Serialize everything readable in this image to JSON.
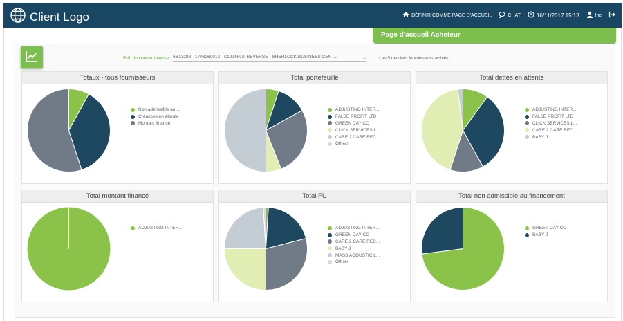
{
  "header": {
    "logo_text": "Client Logo",
    "nav": {
      "home_label": "DÉFINIR COMME PAGE D'ACCUEIL",
      "chat_label": "CHAT",
      "datetime": "16/11/2017 15:13",
      "user_label": "Inc"
    },
    "bg_color": "#194763"
  },
  "banner": {
    "title": "Page d'accueil Acheteur",
    "color": "#7cbf4e"
  },
  "filter": {
    "contract_label": "Réf. du contrat reverse",
    "contract_value": "6B13288 - 1703260012 - CONTRAT REVERSE - SHERLOCK BUSINESS CENT...",
    "info_text": "Les 5 derniers fournisseurs activés"
  },
  "colors": {
    "green": "#8bc34a",
    "navy": "#1d4860",
    "slate": "#707b87",
    "lightgreen": "#e0eeb3",
    "lightgray": "#c4ccd4",
    "palegray": "#d8dadc"
  },
  "icons": {
    "logo": "globe-icon",
    "chart_button": "line-chart-icon",
    "home": "home-icon",
    "chat": "chat-icon",
    "clock": "clock-icon",
    "user": "user-icon",
    "logout": "logout-icon"
  },
  "cards": [
    {
      "title": "Totaux - tous fournisseurs",
      "legend": [
        {
          "label": "Non admissible au ...",
          "color": "#8bc34a"
        },
        {
          "label": "Créances en attente",
          "color": "#1d4860"
        },
        {
          "label": "Montant financé",
          "color": "#707b87"
        }
      ]
    },
    {
      "title": "Total portefeuille",
      "legend": [
        {
          "label": "ADJUSTING INTER...",
          "color": "#8bc34a"
        },
        {
          "label": "FALSE PROFIT LTD",
          "color": "#1d4860"
        },
        {
          "label": "GREEN DAY CO",
          "color": "#707b87"
        },
        {
          "label": "CLICK SERVICES L...",
          "color": "#e0eeb3"
        },
        {
          "label": "CARE 2 CARE REC...",
          "color": "#c4ccd4"
        },
        {
          "label": "Others",
          "color": "#d8dadc"
        }
      ]
    },
    {
      "title": "Total dettes en attente",
      "legend": [
        {
          "label": "ADJUSTING INTER...",
          "color": "#8bc34a"
        },
        {
          "label": "FALSE PROFIT LTD",
          "color": "#1d4860"
        },
        {
          "label": "CLICK SERVICES L...",
          "color": "#707b87"
        },
        {
          "label": "CARE 2 CARE REC...",
          "color": "#e0eeb3"
        },
        {
          "label": "BABY J",
          "color": "#c4ccd4"
        }
      ]
    },
    {
      "title": "Total montant financé",
      "legend": [
        {
          "label": "ADJUSTING INTER...",
          "color": "#8bc34a"
        }
      ]
    },
    {
      "title": "Total FU",
      "legend": [
        {
          "label": "ADJUSTING INTER...",
          "color": "#8bc34a"
        },
        {
          "label": "GREEN DAY CO",
          "color": "#1d4860"
        },
        {
          "label": "CARE 2 CARE REC...",
          "color": "#707b87"
        },
        {
          "label": "BABY J",
          "color": "#e0eeb3"
        },
        {
          "label": "MASS ACOUSTIC L...",
          "color": "#c4ccd4"
        },
        {
          "label": "Others",
          "color": "#d8dadc"
        }
      ]
    },
    {
      "title": "Total non admissible au financement",
      "legend": [
        {
          "label": "GREEN DAY CO",
          "color": "#8bc34a"
        },
        {
          "label": "BABY J",
          "color": "#1d4860"
        }
      ]
    }
  ],
  "chart_data": [
    {
      "type": "pie",
      "title": "Totaux - tous fournisseurs",
      "categories": [
        "Non admissible au ...",
        "Créances en attente",
        "Montant financé"
      ],
      "values": [
        8,
        37,
        55
      ]
    },
    {
      "type": "pie",
      "title": "Total portefeuille",
      "categories": [
        "ADJUSTING INTER...",
        "FALSE PROFIT LTD",
        "GREEN DAY CO",
        "CLICK SERVICES L...",
        "CARE 2 CARE REC...",
        "Others"
      ],
      "values": [
        5,
        12,
        27,
        6,
        50,
        0
      ]
    },
    {
      "type": "pie",
      "title": "Total dettes en attente",
      "categories": [
        "ADJUSTING INTER...",
        "FALSE PROFIT LTD",
        "CLICK SERVICES L...",
        "CARE 2 CARE REC...",
        "BABY J"
      ],
      "values": [
        10,
        32,
        13,
        43,
        2
      ]
    },
    {
      "type": "pie",
      "title": "Total montant financé",
      "categories": [
        "ADJUSTING INTER..."
      ],
      "values": [
        100
      ]
    },
    {
      "type": "pie",
      "title": "Total FU",
      "categories": [
        "ADJUSTING INTER...",
        "GREEN DAY CO",
        "CARE 2 CARE REC...",
        "BABY J",
        "MASS ACOUSTIC L...",
        "Others"
      ],
      "values": [
        1,
        20,
        29,
        25,
        24,
        1
      ]
    },
    {
      "type": "pie",
      "title": "Total non admissible au financement",
      "categories": [
        "GREEN DAY CO",
        "BABY J"
      ],
      "values": [
        73,
        27
      ]
    }
  ]
}
